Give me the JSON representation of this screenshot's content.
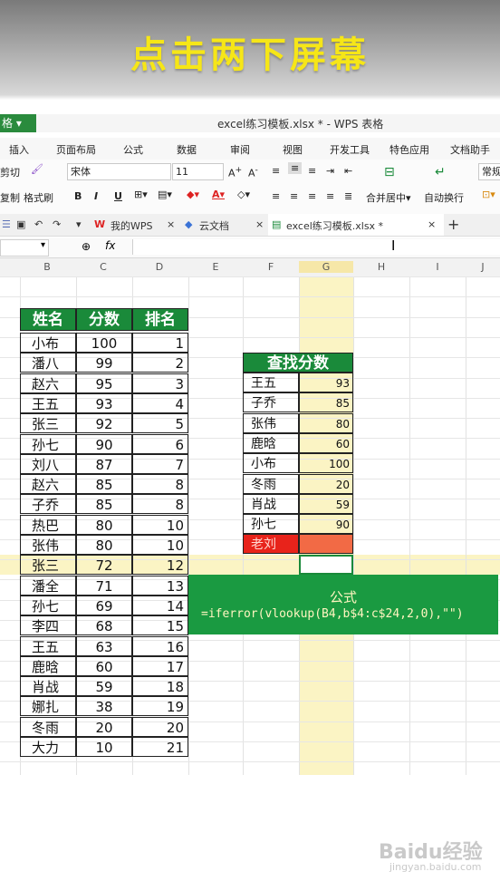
{
  "banner": {
    "text": "点击两下屏幕"
  },
  "window": {
    "app_label": "格",
    "title": "excel练习模板.xlsx * - WPS 表格"
  },
  "menu": [
    "插入",
    "页面布局",
    "公式",
    "数据",
    "审阅",
    "视图",
    "开发工具",
    "特色应用",
    "文档助手"
  ],
  "ribbon": {
    "cut": "剪切",
    "copy": "复制",
    "format_painter": "格式刷",
    "font": "宋体",
    "size": "11",
    "bold": "B",
    "italic": "I",
    "underline": "U",
    "merge": "合并居中",
    "wrap": "自动换行",
    "normal": "常规"
  },
  "tabs": {
    "mywps": "我的WPS",
    "cloud": "云文档",
    "file": "excel练习模板.xlsx *",
    "add": "+"
  },
  "formula_bar": {
    "fx": "fx",
    "content": ""
  },
  "columns": [
    "B",
    "C",
    "D",
    "E",
    "F",
    "G",
    "H",
    "I",
    "J"
  ],
  "score_table": {
    "headers": [
      "姓名",
      "分数",
      "排名"
    ],
    "rows": [
      [
        "小布",
        "100",
        "1"
      ],
      [
        "潘八",
        "99",
        "2"
      ],
      [
        "赵六",
        "95",
        "3"
      ],
      [
        "王五",
        "93",
        "4"
      ],
      [
        "张三",
        "92",
        "5"
      ],
      [
        "孙七",
        "90",
        "6"
      ],
      [
        "刘八",
        "87",
        "7"
      ],
      [
        "赵六",
        "85",
        "8"
      ],
      [
        "子乔",
        "85",
        "8"
      ],
      [
        "热巴",
        "80",
        "10"
      ],
      [
        "张伟",
        "80",
        "10"
      ],
      [
        "张三",
        "72",
        "12"
      ],
      [
        "潘全",
        "71",
        "13"
      ],
      [
        "孙七",
        "69",
        "14"
      ],
      [
        "李四",
        "68",
        "15"
      ],
      [
        "王五",
        "63",
        "16"
      ],
      [
        "鹿晗",
        "60",
        "17"
      ],
      [
        "肖战",
        "59",
        "18"
      ],
      [
        "娜扎",
        "38",
        "19"
      ],
      [
        "冬雨",
        "20",
        "20"
      ],
      [
        "大力",
        "10",
        "21"
      ]
    ]
  },
  "lookup_table": {
    "header": "查找分数",
    "rows": [
      [
        "王五",
        "93"
      ],
      [
        "子乔",
        "85"
      ],
      [
        "张伟",
        "80"
      ],
      [
        "鹿晗",
        "60"
      ],
      [
        "小布",
        "100"
      ],
      [
        "冬雨",
        "20"
      ],
      [
        "肖战",
        "59"
      ],
      [
        "孙七",
        "90"
      ],
      [
        "老刘",
        ""
      ]
    ]
  },
  "formula_box": {
    "title": "公式",
    "formula": "=iferror(vlookup(B4,b$4:c$24,2,0),\"\")"
  },
  "watermark": {
    "logo": "Baidu经验",
    "url": "jingyan.baidu.com"
  }
}
